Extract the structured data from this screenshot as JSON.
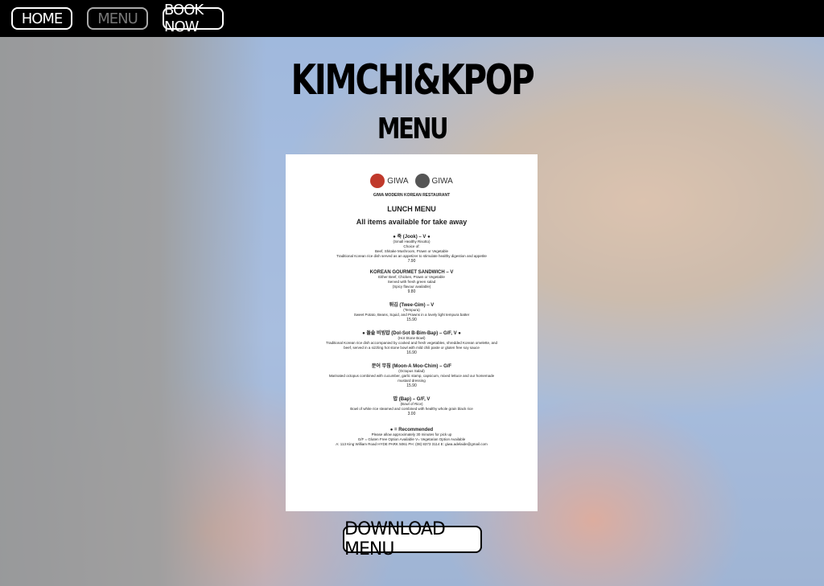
{
  "nav": {
    "home": "HOME",
    "menu": "MENU",
    "book": "BOOK NOW"
  },
  "hero": {
    "site_title": "KIMCHI&KPOP",
    "section_title": "MENU"
  },
  "menu_document": {
    "logo_text_1": "GIWA",
    "logo_text_2": "GIWA",
    "restaurant_name": "GIWA MODERN KOREAN RESTAURANT",
    "heading": "LUNCH MENU",
    "subheading": "All items available for take away",
    "items": [
      {
        "name": "● 죽 (Jook) – V ●",
        "lines": [
          "(Small Healthy Risotto)",
          "Choice of:",
          "Beef, Shitake Mushroom, Prawn or Vegetable",
          "Traditional Korean rice dish served as an appetizer to stimulate healthy digestion and appetite"
        ],
        "price": "7.90"
      },
      {
        "name": "KOREAN GOURMET SANDWICH – V",
        "lines": [
          "Either Beef, Chicken, Prawn or Vegetable",
          "Served with fresh green salad",
          "(Spicy flavour available)"
        ],
        "price": "9.80"
      },
      {
        "name": "튀김 (Twee-Gim) – V",
        "lines": [
          "(Tempura)",
          "Sweet Potato, Beans, Squid, and Prawns in a lovely light tempura batter"
        ],
        "price": "15.90"
      },
      {
        "name": "● 돌솥 비빔밥 (Dol-Sot B-Bim-Bap) – G/F, V ●",
        "lines": [
          "(Hot Stone Bowl)",
          "Traditional Korean rice dish accompanied by cooked and fresh vegetables, shredded Korean omelette, and",
          "beef, served in a sizzling hot stone bowl with mild chili paste or gluten free soy sauce"
        ],
        "price": "16.90"
      },
      {
        "name": "문어 무침 (Moon-A Moo-Chim) – G/F",
        "lines": [
          "(Octopus Salad)",
          "Marinated octopus combined with cucumber, garlic stamp, capsicum, mixed lettuce and our homemade",
          "mustard dressing"
        ],
        "price": "15.90"
      },
      {
        "name": "밥 (Bap) – G/F, V",
        "lines": [
          "(Bowl of Rice)",
          "Bowl of white rice steamed and combined with healthy whole grain black rice"
        ],
        "price": "3.00"
      }
    ],
    "footer_recommended": "● = Recommended",
    "footer_lines": [
      "Please allow approximately 30 minutes for pick up",
      "G/F = Gluten Free Option Available V= Vegetarian Option Available",
      "A: 113 King William Road HYDE PARK 5061 PH: (08) 8373 3114 E: giwa.adelaide@gmail.com"
    ]
  },
  "download_button": "DOWNLOAD MENU",
  "colors": {
    "topbar": "#000000",
    "logo_red": "#c0392b",
    "logo_grey": "#555555"
  }
}
